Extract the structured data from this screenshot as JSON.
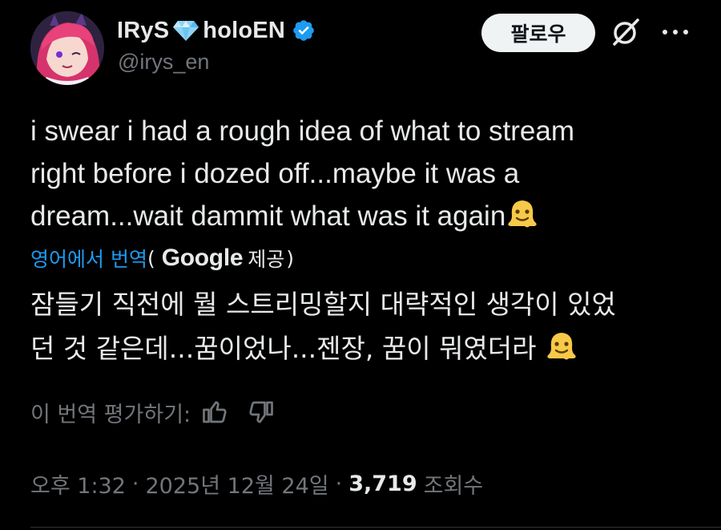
{
  "author": {
    "name_part1": "IRyS",
    "name_part2": "holoEN",
    "handle": "@irys_en",
    "avatar": "avatar-portrait",
    "gem_icon": "gem-icon",
    "verified_icon": "verified-badge-icon"
  },
  "header": {
    "follow_label": "팔로우",
    "grok_icon": "grok-icon",
    "more_icon": "more-dots-icon"
  },
  "tweet": {
    "line1": "i swear i had a rough idea of what to stream",
    "line2": "right before i dozed off...maybe it was a",
    "line3": "dream...wait dammit what was it again",
    "emoji": "melting-face-emoji"
  },
  "translation": {
    "link_label": "영어에서 번역",
    "open_paren": "(",
    "provider": "Google",
    "provided_by": "제공",
    "close_paren": ")",
    "line1": "잠들기 직전에 뭘 스트리밍할지 대략적인 생각이 있었",
    "line2": "던 것 같은데...꿈이었나...젠장, 꿈이 뭐였더라 "
  },
  "rating": {
    "label": "이 번역 평가하기:",
    "thumbs_up_icon": "thumbs-up-icon",
    "thumbs_down_icon": "thumbs-down-icon"
  },
  "meta": {
    "time": "오후 1:32",
    "separator": "·",
    "date": "2025년 12월 24일",
    "views_count": "3,719",
    "views_label": "조회수"
  },
  "colors": {
    "background": "#000000",
    "text": "#e7e9ea",
    "secondary": "#71767b",
    "link": "#1d9bf0",
    "verified": "#1d9bf0",
    "follow_bg": "#eff3f4"
  }
}
